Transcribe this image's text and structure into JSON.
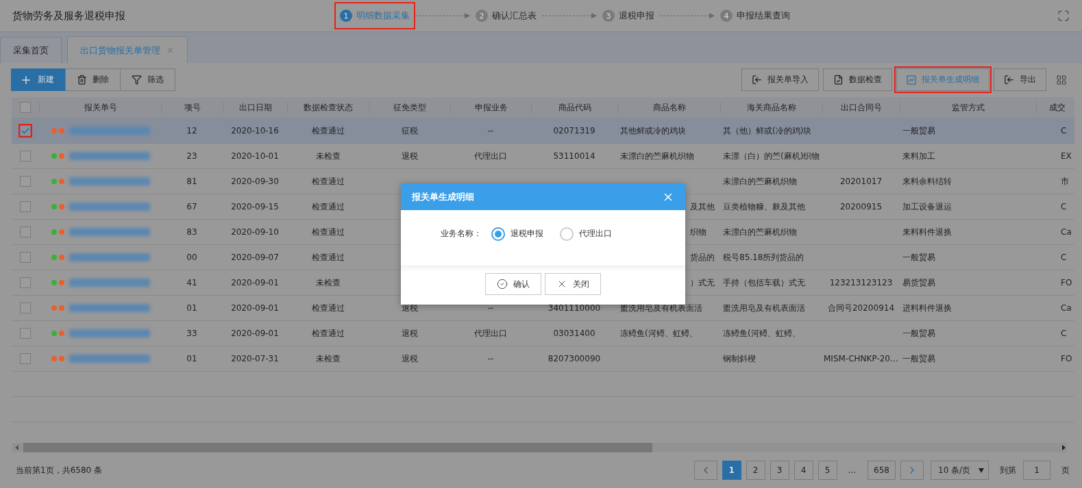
{
  "app_title": "货物劳务及服务退税申报",
  "steps": [
    {
      "number": "1",
      "label": "明细数据采集",
      "selected": true,
      "annotated": true
    },
    {
      "number": "2",
      "label": "确认汇总表",
      "selected": false,
      "annotated": false
    },
    {
      "number": "3",
      "label": "退税申报",
      "selected": false,
      "annotated": false
    },
    {
      "number": "4",
      "label": "申报结果查询",
      "selected": false,
      "annotated": false
    }
  ],
  "tabs": [
    {
      "label": "采集首页",
      "selected": false,
      "closable": false
    },
    {
      "label": "出口货物报关单管理",
      "selected": true,
      "closable": true
    }
  ],
  "toolbar_left": [
    {
      "kind": "new",
      "label": "新建"
    },
    {
      "kind": "delete",
      "label": "删除"
    },
    {
      "kind": "filter",
      "label": "筛选"
    }
  ],
  "toolbar_right": [
    {
      "kind": "import",
      "label": "报关单导入",
      "annotated": false
    },
    {
      "kind": "check",
      "label": "数据检查",
      "annotated": false
    },
    {
      "kind": "generate",
      "label": "报关单生成明细",
      "annotated": true
    },
    {
      "kind": "export",
      "label": "导出",
      "annotated": false
    }
  ],
  "table": {
    "header_checkbox": {
      "checked": false
    },
    "columns": [
      "报关单号",
      "项号",
      "出口日期",
      "数据检查状态",
      "征免类型",
      "申报业务",
      "商品代码",
      "商品名称",
      "海关商品名称",
      "出口合同号",
      "监管方式",
      "成交"
    ],
    "rows": [
      {
        "checked": true,
        "selected": true,
        "annotated": true,
        "dots": [
          {
            "color": "#e8602c"
          },
          {
            "color": "#e8602c"
          }
        ],
        "item_no": "12",
        "date": "2020-10-16",
        "status": "检查通过",
        "tax_type": "征税",
        "business": "--",
        "code": "02071319",
        "goods_name": "其他鲜或冷的鸡块",
        "customs_name": "其（他）鲜或(冷的鸡)块",
        "mode": "一般贸易",
        "last": "C"
      },
      {
        "checked": false,
        "selected": false,
        "dots": [
          {
            "color": "#3cb034"
          },
          {
            "color": "#e8602c"
          }
        ],
        "item_no": "23",
        "date": "2020-10-01",
        "status": "未检查",
        "tax_type": "退税",
        "business": "代理出口",
        "code": "53110014",
        "goods_name": "未漂白的苎麻机织物",
        "customs_name": "未漂（白）的苎(麻机)织物",
        "mode": "来料加工",
        "last": "EX"
      },
      {
        "checked": false,
        "selected": false,
        "dots": [
          {
            "color": "#3cb034"
          },
          {
            "color": "#e8602c"
          }
        ],
        "item_no": "81",
        "date": "2020-09-30",
        "status": "检查通过",
        "customs_name": "未漂白的苎麻机织物",
        "contract": "20201017",
        "mode": "来料余料结转",
        "last": "市"
      },
      {
        "checked": false,
        "selected": false,
        "dots": [
          {
            "color": "#3cb034"
          },
          {
            "color": "#e8602c"
          }
        ],
        "item_no": "67",
        "date": "2020-09-15",
        "status": "检查通过",
        "goods_name_tail": "及其他",
        "customs_name": "豆类植物糠、麸及其他",
        "contract": "20200915",
        "mode": "加工设备退运",
        "last": "C"
      },
      {
        "checked": false,
        "selected": false,
        "dots": [
          {
            "color": "#3cb034"
          },
          {
            "color": "#e8602c"
          }
        ],
        "item_no": "83",
        "date": "2020-09-10",
        "status": "检查通过",
        "goods_name_tail": "织物",
        "customs_name": "未漂白的苎麻机织物",
        "mode": "来料料件退换",
        "last": "Ca"
      },
      {
        "checked": false,
        "selected": false,
        "dots": [
          {
            "color": "#3cb034"
          },
          {
            "color": "#e8602c"
          }
        ],
        "item_no": "00",
        "date": "2020-09-07",
        "status": "检查通过",
        "goods_name_tail": "货品的",
        "customs_name": "税号85.18所列货品的",
        "mode": "一般贸易",
        "last": "C"
      },
      {
        "checked": false,
        "selected": false,
        "dots": [
          {
            "color": "#3cb034"
          },
          {
            "color": "#e8602c"
          }
        ],
        "item_no": "41",
        "date": "2020-09-01",
        "status": "未检查",
        "goods_name_tail": "）式无",
        "customs_name": "手持（包括车载）式无",
        "contract": "123213123123",
        "mode": "易货贸易",
        "last": "FO"
      },
      {
        "checked": false,
        "selected": false,
        "dots": [
          {
            "color": "#e8602c"
          },
          {
            "color": "#e8602c"
          }
        ],
        "item_no": "01",
        "date": "2020-09-01",
        "status": "检查通过",
        "tax_type": "退税",
        "business": "--",
        "code": "3401110000",
        "goods_name": "盥洗用皂及有机表面活",
        "customs_name": "盥洗用皂及有机表面活",
        "contract": "合同号20200914",
        "mode": "进料料件退换",
        "last": "Ca"
      },
      {
        "checked": false,
        "selected": false,
        "dots": [
          {
            "color": "#3cb034"
          },
          {
            "color": "#e8602c"
          }
        ],
        "item_no": "33",
        "date": "2020-09-01",
        "status": "检查通过",
        "tax_type": "退税",
        "business": "代理出口",
        "code": "03031400",
        "goods_name": "冻鳟鱼(河鳟、虹鳟、",
        "customs_name": "冻鳟鱼(河鳟、虹鳟、",
        "mode": "一般贸易",
        "last": "C"
      },
      {
        "checked": false,
        "selected": false,
        "dots": [
          {
            "color": "#e8602c"
          },
          {
            "color": "#e8602c"
          }
        ],
        "item_no": "01",
        "date": "2020-07-31",
        "status": "未检查",
        "tax_type": "退税",
        "business": "--",
        "code": "8207300090",
        "customs_name": "钢制斜楔",
        "contract": "MISM-CHNKP-20…",
        "mode": "一般贸易",
        "last": "FO"
      }
    ]
  },
  "pagination": {
    "summary": "当前第1页，共6580 条",
    "pages": [
      {
        "label": "1",
        "selected": true
      },
      {
        "label": "2",
        "selected": false
      },
      {
        "label": "3",
        "selected": false
      },
      {
        "label": "4",
        "selected": false
      },
      {
        "label": "5",
        "selected": false
      },
      {
        "label": "...",
        "kind": "gap"
      },
      {
        "label": "658",
        "selected": false
      }
    ],
    "page_size": "10 条/页",
    "goto_label": "到第",
    "goto_value": "1",
    "goto_suffix": "页"
  },
  "dialog": {
    "title": "报关单生成明细",
    "field_label": "业务名称：",
    "options": [
      {
        "label": "退税申报",
        "selected": true
      },
      {
        "label": "代理出口",
        "selected": false
      }
    ],
    "buttons": [
      {
        "kind": "confirm",
        "label": "确认"
      },
      {
        "kind": "close",
        "label": "关闭"
      }
    ]
  }
}
